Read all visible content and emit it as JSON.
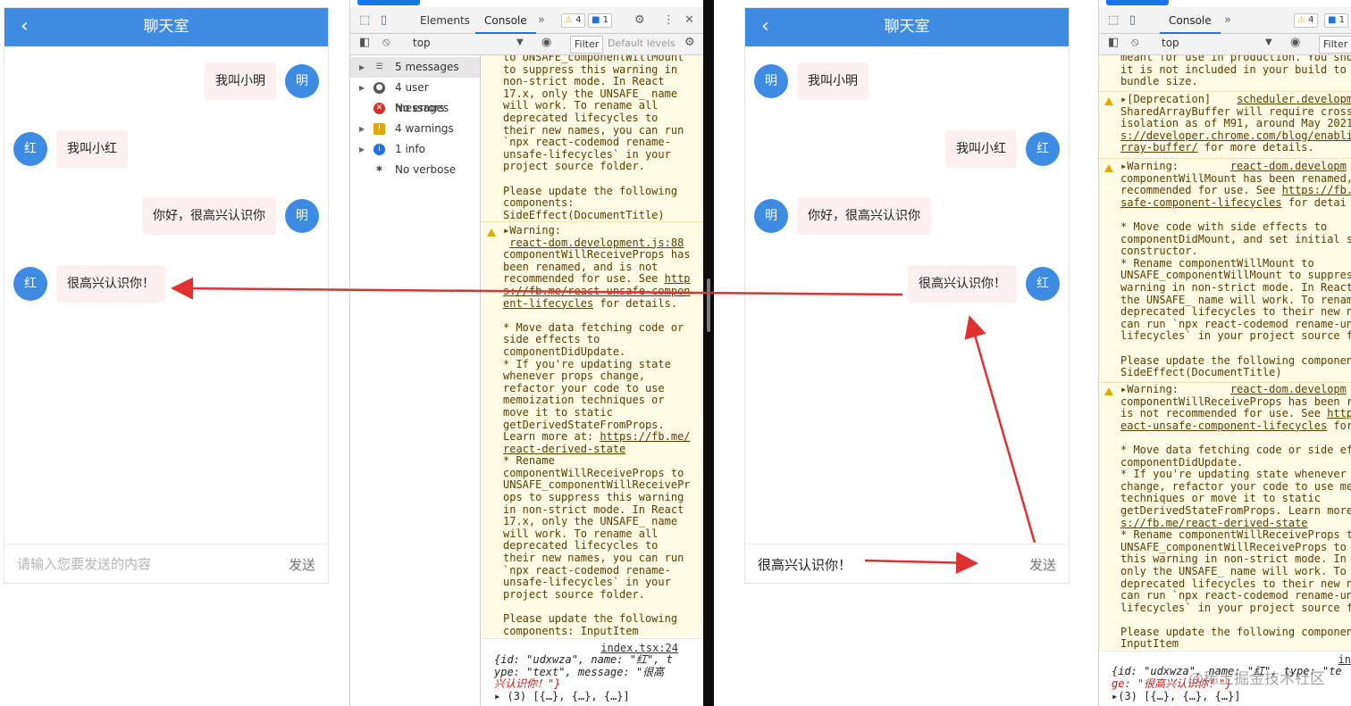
{
  "colors": {
    "accent": "#3d8be3",
    "bubble": "#fcf0f0",
    "warning_bg": "#fffbe5",
    "arrow": "#e03131"
  },
  "chat_left": {
    "title": "聊天室",
    "messages": [
      {
        "side": "right",
        "avatar": "明",
        "text": "我叫小明"
      },
      {
        "side": "left",
        "avatar": "红",
        "text": "我叫小红"
      },
      {
        "side": "right",
        "avatar": "明",
        "text": "你好，很高兴认识你"
      },
      {
        "side": "left",
        "avatar": "红",
        "text": "很高兴认识你！"
      }
    ],
    "input_placeholder": "请输入您要发送的内容",
    "input_value": "",
    "send_label": "发送"
  },
  "chat_right": {
    "title": "聊天室",
    "messages": [
      {
        "side": "left",
        "avatar": "明",
        "text": "我叫小明"
      },
      {
        "side": "right",
        "avatar": "红",
        "text": "我叫小红"
      },
      {
        "side": "left",
        "avatar": "明",
        "text": "你好，很高兴认识你"
      },
      {
        "side": "right",
        "avatar": "红",
        "text": "很高兴认识你！"
      }
    ],
    "input_placeholder": "",
    "input_value": "很高兴认识你！",
    "send_label": "发送"
  },
  "devtools_left": {
    "tabs": [
      "Elements",
      "Console"
    ],
    "warn_count": "4",
    "msg_count": "1",
    "context": "top",
    "filter_label": "Filter",
    "levels_label": "Default levels",
    "sidebar": [
      {
        "label": "5 messages",
        "icon": "list-icon"
      },
      {
        "label": "4 user messages",
        "icon": "user-icon"
      },
      {
        "label": "No errors",
        "icon": "error-icon"
      },
      {
        "label": "4 warnings",
        "icon": "warning-icon"
      },
      {
        "label": "1 info",
        "icon": "info-icon"
      },
      {
        "label": "No verbose",
        "icon": "bug-icon"
      }
    ],
    "log1": "to UNSAFE_componentWillMount\nto suppress this warning in\nnon-strict mode. In React\n17.x, only the UNSAFE_ name\nwill work. To rename all\ndeprecated lifecycles to\ntheir new names, you can run\n`npx react-codemod rename-\nunsafe-lifecycles` in your\nproject source folder.\n\nPlease update the following\ncomponents:\nSideEffect(DocumentTitle)",
    "warn2_head": "Warning:",
    "warn2_link": "react-dom.development.js:88",
    "log2a": "componentWillReceiveProps has\nbeen renamed, and is not\nrecommended for use. See ",
    "log2_link": "http\ns://fb.me/react-unsafe-compon\nent-lifecycles",
    "log2b": " for details.\n\n* Move data fetching code or\nside effects to\ncomponentDidUpdate.\n* If you're updating state\nwhenever props change,\nrefactor your code to use\nmemoization techniques or\nmove it to static\ngetDerivedStateFromProps.\nLearn more at: ",
    "log2_link2": "https://fb.me/\nreact-derived-state",
    "log2c": "\n* Rename\ncomponentWillReceiveProps to\nUNSAFE_componentWillReceivePr\nops to suppress this warning\nin non-strict mode. In React\n17.x, only the UNSAFE_ name\nwill work. To rename all\ndeprecated lifecycles to\ntheir new names, you can run\n`npx react-codemod rename-\nunsafe-lifecycles` in your\nproject source folder.\n\nPlease update the following\ncomponents: InputItem",
    "src": "index.tsx:24",
    "obj_line1": "{id: \"udxwza\", name: \"红\", t",
    "obj_line2": "ype: \"text\", message: \"很高",
    "obj_line3": "兴认识你！\"}",
    "obj_line4": "(3) [{…}, {…}, {…}]"
  },
  "devtools_right": {
    "tabs": [
      "Console"
    ],
    "warn_count": "4",
    "msg_count": "1",
    "context": "top",
    "filter_label": "Filter",
    "log0": "meant for use in production. You shou\nit is not included in your build to r\nbundle size.",
    "dep_head": "[Deprecation]",
    "dep_link": "scheduler.developme",
    "dep_body": "SharedArrayBuffer will require cross-\nisolation as of M91, around May 2021.\n",
    "dep_link2": "s://developer.chrome.com/blog/enablin\nrray-buffer/",
    "dep_tail": " for more details.",
    "w1_head": "Warning:",
    "w1_link": "react-dom.developm",
    "w1_body": "componentWillMount has been renamed, a\nrecommended for use. See ",
    "w1_link2": "https://fb.me\nsafe-component-lifecycles",
    "w1_tail": " for detai\n\n* Move code with side effects to\ncomponentDidMount, and set initial st\nconstructor.\n* Rename componentWillMount to\nUNSAFE_componentWillMount to suppress\nwarning in non-strict mode. In React \nthe UNSAFE_ name will work. To rename\ndeprecated lifecycles to their new na\ncan run `npx react-codemod rename-uns\nlifecycles` in your project source fo\n\nPlease update the following component\nSideEffect(DocumentTitle)",
    "w2_head": "Warning:",
    "w2_link": "react-dom.developm",
    "w2_body": "componentWillReceiveProps has been re\nis not recommended for use. See ",
    "w2_link2": "https\neact-unsafe-component-lifecycles",
    "w2_tail": " for \n\n* Move data fetching code or side eff\ncomponentDidUpdate.\n* If you're updating state whenever p\nchange, refactor your code to use mem\ntechniques or move it to static\ngetDerivedStateFromProps. Learn more \n",
    "w2_link3": "s://fb.me/react-derived-state",
    "w2_tail2": "\n* Rename componentWillReceiveProps to\nUNSAFE_componentWillReceiveProps to s\nthis warning in non-strict mode. In R\nonly the UNSAFE_ name will work. To r\ndeprecated lifecycles to their new na\ncan run `npx react-codemod rename-uns\nlifecycles` in your project source fo\n\nPlease update the following component\nInputItem",
    "src": "in",
    "obj_line1": "{id: \"udxwza\", name: \"红\", type: \"te",
    "obj_line2": "ge: \"很高兴认识你！\"}",
    "obj_line3": "(3) [{…}, {…}, {…}]"
  },
  "watermark": "@稀土掘金技术社区"
}
